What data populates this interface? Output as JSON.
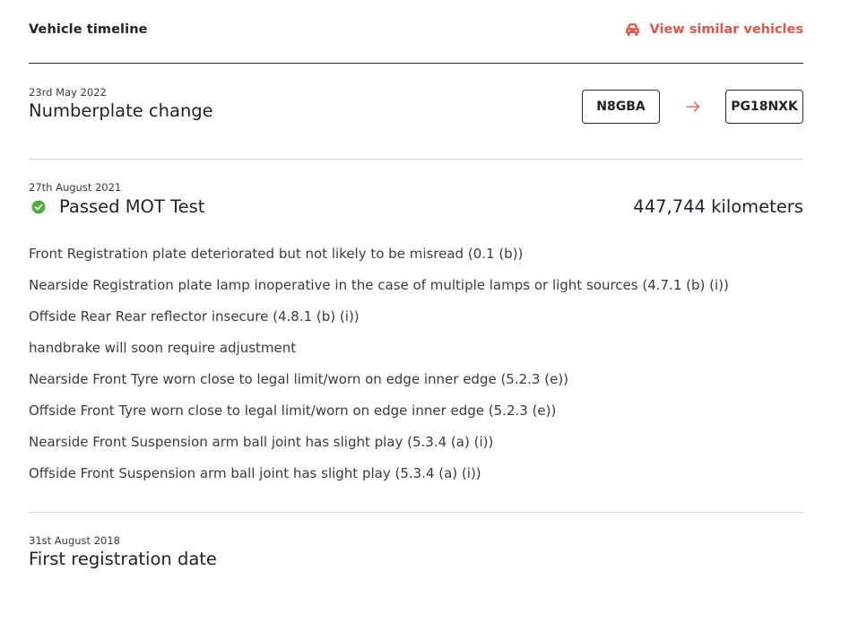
{
  "header": {
    "title": "Vehicle timeline",
    "similar_link_label": "View similar vehicles",
    "similar_link_icon": "car-icon",
    "accent_color": "#e0574a"
  },
  "timeline": {
    "plate_change": {
      "date": "23rd May 2022",
      "title": "Numberplate change",
      "old_plate": "N8GBA",
      "new_plate": "PG18NXK",
      "arrow_icon": "arrow-right-icon"
    },
    "mot_test": {
      "date": "27th August 2021",
      "status_icon": "check-circle-icon",
      "status_color": "#4caf3a",
      "title": "Passed MOT Test",
      "mileage": "447,744 kilometers",
      "advisories": [
        "Front Registration plate deteriorated but not likely to be misread (0.1 (b))",
        "Nearside Registration plate lamp inoperative in the case of multiple lamps or light sources (4.7.1 (b) (i))",
        "Offside Rear Rear reflector insecure (4.8.1 (b) (i))",
        "handbrake will soon require adjustment",
        "Nearside Front Tyre worn close to legal limit/worn on edge inner edge (5.2.3 (e))",
        "Offside Front Tyre worn close to legal limit/worn on edge inner edge (5.2.3 (e))",
        "Nearside Front Suspension arm ball joint has slight play (5.3.4 (a) (i))",
        "Offside Front Suspension arm ball joint has slight play (5.3.4 (a) (i))"
      ]
    },
    "first_registration": {
      "date": "31st August 2018",
      "title": "First registration date"
    }
  }
}
